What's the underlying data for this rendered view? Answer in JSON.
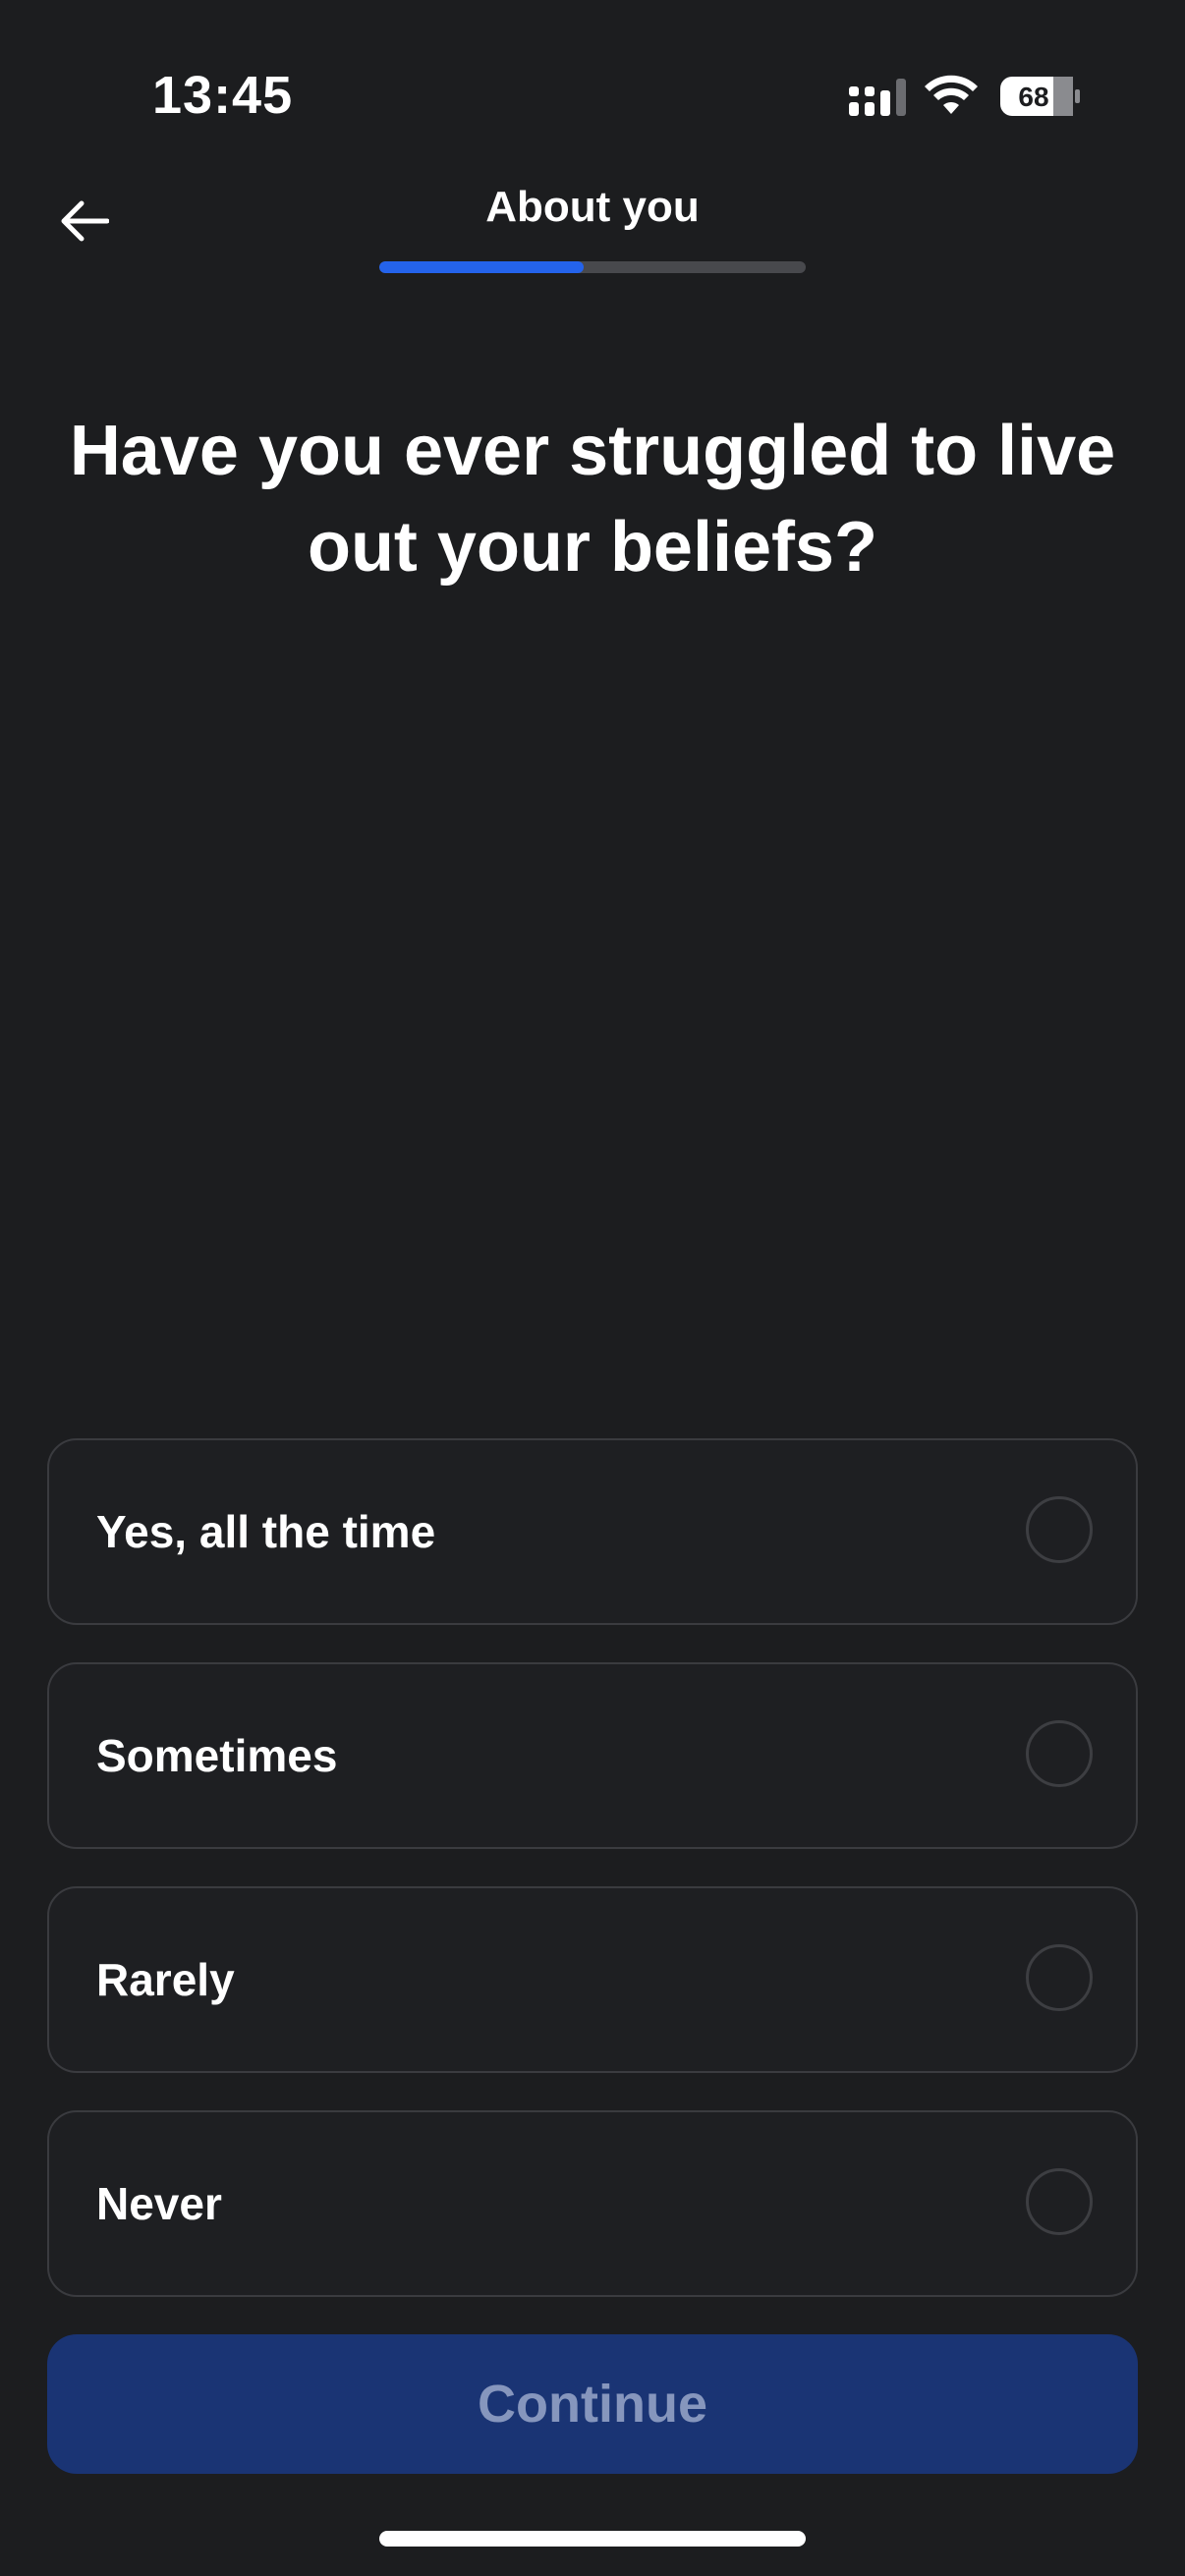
{
  "status_bar": {
    "time": "13:45",
    "battery": "68",
    "icons": [
      "signal-icon",
      "wifi-icon",
      "battery-icon"
    ]
  },
  "header": {
    "title": "About you",
    "back_icon": "arrow-left-icon",
    "progress": 0.48
  },
  "question": {
    "text": "Have you ever struggled to live out your beliefs?"
  },
  "options": [
    {
      "label": "Yes, all the time",
      "selected": false
    },
    {
      "label": "Sometimes",
      "selected": false
    },
    {
      "label": "Rarely",
      "selected": false
    },
    {
      "label": "Never",
      "selected": false
    }
  ],
  "continue_button": {
    "label": "Continue",
    "enabled": false
  },
  "colors": {
    "background": "#1c1d1f",
    "accent": "#2463eb",
    "button_disabled": "#1a3474",
    "button_text_disabled": "#8696bd"
  }
}
